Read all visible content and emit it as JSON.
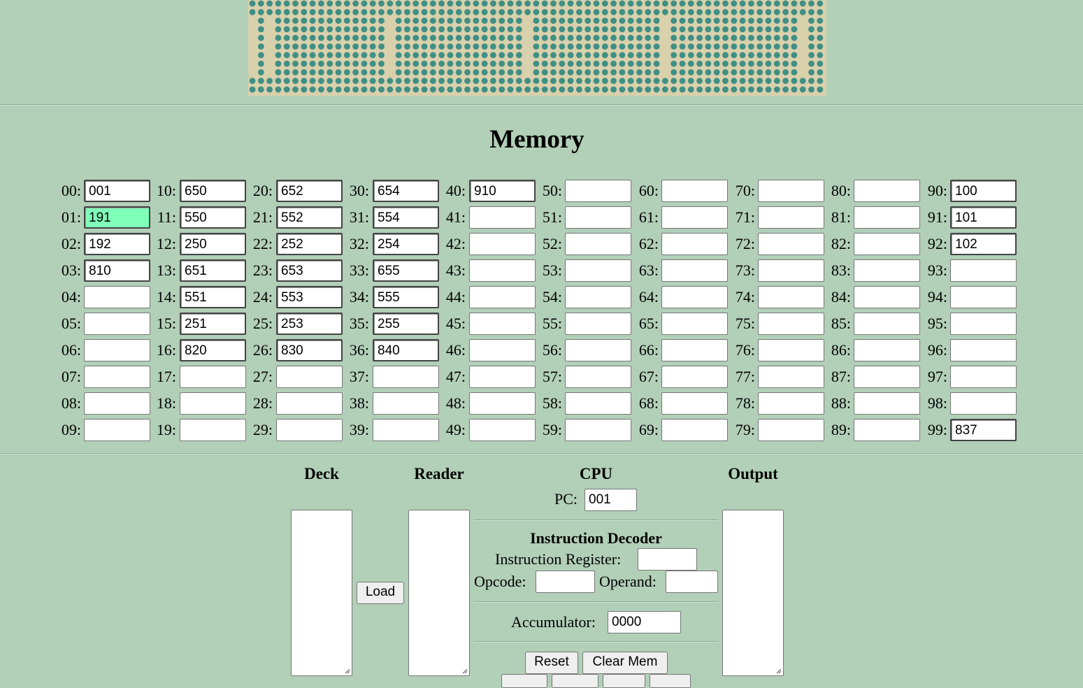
{
  "memory": {
    "title": "Memory",
    "cells": [
      {
        "label": "00:",
        "value": "001"
      },
      {
        "label": "01:",
        "value": "191"
      },
      {
        "label": "02:",
        "value": "192"
      },
      {
        "label": "03:",
        "value": "810"
      },
      {
        "label": "04:",
        "value": ""
      },
      {
        "label": "05:",
        "value": ""
      },
      {
        "label": "06:",
        "value": ""
      },
      {
        "label": "07:",
        "value": ""
      },
      {
        "label": "08:",
        "value": ""
      },
      {
        "label": "09:",
        "value": ""
      },
      {
        "label": "10:",
        "value": "650"
      },
      {
        "label": "11:",
        "value": "550"
      },
      {
        "label": "12:",
        "value": "250"
      },
      {
        "label": "13:",
        "value": "651"
      },
      {
        "label": "14:",
        "value": "551"
      },
      {
        "label": "15:",
        "value": "251"
      },
      {
        "label": "16:",
        "value": "820"
      },
      {
        "label": "17:",
        "value": ""
      },
      {
        "label": "18:",
        "value": ""
      },
      {
        "label": "19:",
        "value": ""
      },
      {
        "label": "20:",
        "value": "652"
      },
      {
        "label": "21:",
        "value": "552"
      },
      {
        "label": "22:",
        "value": "252"
      },
      {
        "label": "23:",
        "value": "653"
      },
      {
        "label": "24:",
        "value": "553"
      },
      {
        "label": "25:",
        "value": "253"
      },
      {
        "label": "26:",
        "value": "830"
      },
      {
        "label": "27:",
        "value": ""
      },
      {
        "label": "28:",
        "value": ""
      },
      {
        "label": "29:",
        "value": ""
      },
      {
        "label": "30:",
        "value": "654"
      },
      {
        "label": "31:",
        "value": "554"
      },
      {
        "label": "32:",
        "value": "254"
      },
      {
        "label": "33:",
        "value": "655"
      },
      {
        "label": "34:",
        "value": "555"
      },
      {
        "label": "35:",
        "value": "255"
      },
      {
        "label": "36:",
        "value": "840"
      },
      {
        "label": "37:",
        "value": ""
      },
      {
        "label": "38:",
        "value": ""
      },
      {
        "label": "39:",
        "value": ""
      },
      {
        "label": "40:",
        "value": "910"
      },
      {
        "label": "41:",
        "value": ""
      },
      {
        "label": "42:",
        "value": ""
      },
      {
        "label": "43:",
        "value": ""
      },
      {
        "label": "44:",
        "value": ""
      },
      {
        "label": "45:",
        "value": ""
      },
      {
        "label": "46:",
        "value": ""
      },
      {
        "label": "47:",
        "value": ""
      },
      {
        "label": "48:",
        "value": ""
      },
      {
        "label": "49:",
        "value": ""
      },
      {
        "label": "50:",
        "value": ""
      },
      {
        "label": "51:",
        "value": ""
      },
      {
        "label": "52:",
        "value": ""
      },
      {
        "label": "53:",
        "value": ""
      },
      {
        "label": "54:",
        "value": ""
      },
      {
        "label": "55:",
        "value": ""
      },
      {
        "label": "56:",
        "value": ""
      },
      {
        "label": "57:",
        "value": ""
      },
      {
        "label": "58:",
        "value": ""
      },
      {
        "label": "59:",
        "value": ""
      },
      {
        "label": "60:",
        "value": ""
      },
      {
        "label": "61:",
        "value": ""
      },
      {
        "label": "62:",
        "value": ""
      },
      {
        "label": "63:",
        "value": ""
      },
      {
        "label": "64:",
        "value": ""
      },
      {
        "label": "65:",
        "value": ""
      },
      {
        "label": "66:",
        "value": ""
      },
      {
        "label": "67:",
        "value": ""
      },
      {
        "label": "68:",
        "value": ""
      },
      {
        "label": "69:",
        "value": ""
      },
      {
        "label": "70:",
        "value": ""
      },
      {
        "label": "71:",
        "value": ""
      },
      {
        "label": "72:",
        "value": ""
      },
      {
        "label": "73:",
        "value": ""
      },
      {
        "label": "74:",
        "value": ""
      },
      {
        "label": "75:",
        "value": ""
      },
      {
        "label": "76:",
        "value": ""
      },
      {
        "label": "77:",
        "value": ""
      },
      {
        "label": "78:",
        "value": ""
      },
      {
        "label": "79:",
        "value": ""
      },
      {
        "label": "80:",
        "value": ""
      },
      {
        "label": "81:",
        "value": ""
      },
      {
        "label": "82:",
        "value": ""
      },
      {
        "label": "83:",
        "value": ""
      },
      {
        "label": "84:",
        "value": ""
      },
      {
        "label": "85:",
        "value": ""
      },
      {
        "label": "86:",
        "value": ""
      },
      {
        "label": "87:",
        "value": ""
      },
      {
        "label": "88:",
        "value": ""
      },
      {
        "label": "89:",
        "value": ""
      },
      {
        "label": "90:",
        "value": "100"
      },
      {
        "label": "91:",
        "value": "101"
      },
      {
        "label": "92:",
        "value": "102"
      },
      {
        "label": "93:",
        "value": ""
      },
      {
        "label": "94:",
        "value": ""
      },
      {
        "label": "95:",
        "value": ""
      },
      {
        "label": "96:",
        "value": ""
      },
      {
        "label": "97:",
        "value": ""
      },
      {
        "label": "98:",
        "value": ""
      },
      {
        "label": "99:",
        "value": "837"
      }
    ],
    "active_cell": "01:",
    "highlight_color": "#80ffb8"
  },
  "deck": {
    "title": "Deck",
    "content": ""
  },
  "load_button": "Load",
  "reader": {
    "title": "Reader",
    "content": ""
  },
  "cpu": {
    "title": "CPU",
    "pc_label": "PC:",
    "pc_value": "001",
    "decoder_title": "Instruction Decoder",
    "ir_label": "Instruction Register:",
    "ir_value": "",
    "opcode_label": "Opcode:",
    "opcode_value": "",
    "operand_label": "Operand:",
    "operand_value": "",
    "acc_label": "Accumulator:",
    "acc_value": "0000",
    "reset_button": "Reset",
    "clear_mem_button": "Clear Mem"
  },
  "output": {
    "title": "Output",
    "content": ""
  },
  "colors": {
    "background": "#b2cfb8",
    "banner_dots": "#3f8f84",
    "banner_bg": "#d9d0ac"
  },
  "banner_icon": "punched-card-logo-image"
}
